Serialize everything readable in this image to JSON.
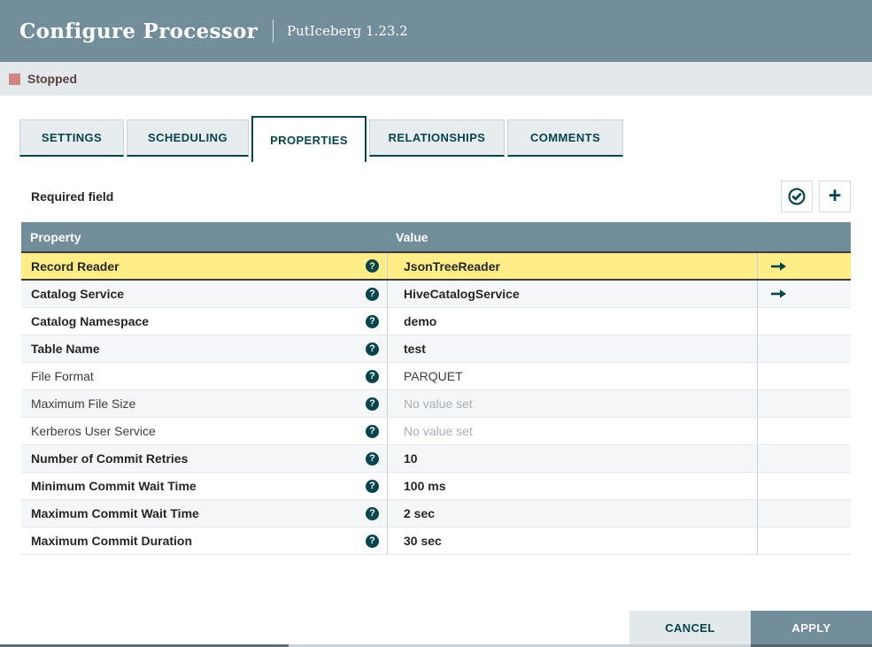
{
  "dialog": {
    "title": "Configure Processor",
    "subtitle": "PutIceberg 1.23.2",
    "status": {
      "label": "Stopped",
      "color": "#d18686"
    }
  },
  "tabs": [
    {
      "label": "SETTINGS",
      "active": false
    },
    {
      "label": "SCHEDULING",
      "active": false
    },
    {
      "label": "PROPERTIES",
      "active": true
    },
    {
      "label": "RELATIONSHIPS",
      "active": false
    },
    {
      "label": "COMMENTS",
      "active": false
    }
  ],
  "toolbar": {
    "required_label": "Required field",
    "verify_icon": "verify-properties-check-circle",
    "add_icon": "add-property-plus"
  },
  "icons": {
    "help_glyph": "?",
    "plus_glyph": "+"
  },
  "table": {
    "columns": [
      "Property",
      "Value",
      ""
    ],
    "rows": [
      {
        "property": "Record Reader",
        "value": "JsonTreeReader",
        "required": true,
        "unset": false,
        "has_arrow": true,
        "selected": true
      },
      {
        "property": "Catalog Service",
        "value": "HiveCatalogService",
        "required": true,
        "unset": false,
        "has_arrow": true,
        "selected": false
      },
      {
        "property": "Catalog Namespace",
        "value": "demo",
        "required": true,
        "unset": false,
        "has_arrow": false,
        "selected": false
      },
      {
        "property": "Table Name",
        "value": "test",
        "required": true,
        "unset": false,
        "has_arrow": false,
        "selected": false
      },
      {
        "property": "File Format",
        "value": "PARQUET",
        "required": false,
        "unset": false,
        "has_arrow": false,
        "selected": false
      },
      {
        "property": "Maximum File Size",
        "value": "No value set",
        "required": false,
        "unset": true,
        "has_arrow": false,
        "selected": false
      },
      {
        "property": "Kerberos User Service",
        "value": "No value set",
        "required": false,
        "unset": true,
        "has_arrow": false,
        "selected": false
      },
      {
        "property": "Number of Commit Retries",
        "value": "10",
        "required": true,
        "unset": false,
        "has_arrow": false,
        "selected": false
      },
      {
        "property": "Minimum Commit Wait Time",
        "value": "100 ms",
        "required": true,
        "unset": false,
        "has_arrow": false,
        "selected": false
      },
      {
        "property": "Maximum Commit Wait Time",
        "value": "2 sec",
        "required": true,
        "unset": false,
        "has_arrow": false,
        "selected": false
      },
      {
        "property": "Maximum Commit Duration",
        "value": "30 sec",
        "required": true,
        "unset": false,
        "has_arrow": false,
        "selected": false
      }
    ]
  },
  "footer": {
    "cancel_label": "CANCEL",
    "apply_label": "APPLY"
  },
  "colors": {
    "header_bg": "#728e9b",
    "status_bar_bg": "#e3e8eb",
    "accent_teal": "#07454d",
    "selected_row": "#ffee87",
    "stopped_square": "#d18686",
    "alt_row": "#f4f6f7"
  }
}
